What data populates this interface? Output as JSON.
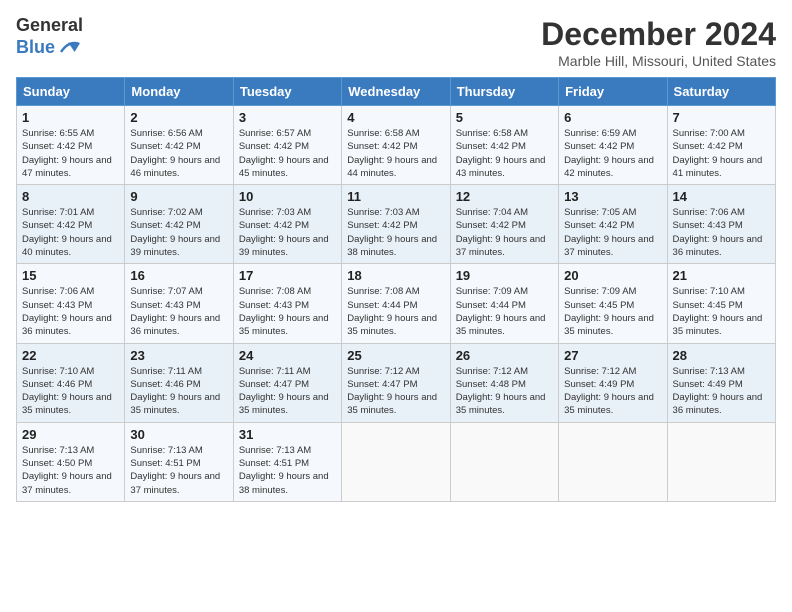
{
  "logo": {
    "general": "General",
    "blue": "Blue"
  },
  "title": "December 2024",
  "location": "Marble Hill, Missouri, United States",
  "days_of_week": [
    "Sunday",
    "Monday",
    "Tuesday",
    "Wednesday",
    "Thursday",
    "Friday",
    "Saturday"
  ],
  "weeks": [
    [
      {
        "day": "1",
        "sunrise": "6:55 AM",
        "sunset": "4:42 PM",
        "daylight": "9 hours and 47 minutes."
      },
      {
        "day": "2",
        "sunrise": "6:56 AM",
        "sunset": "4:42 PM",
        "daylight": "9 hours and 46 minutes."
      },
      {
        "day": "3",
        "sunrise": "6:57 AM",
        "sunset": "4:42 PM",
        "daylight": "9 hours and 45 minutes."
      },
      {
        "day": "4",
        "sunrise": "6:58 AM",
        "sunset": "4:42 PM",
        "daylight": "9 hours and 44 minutes."
      },
      {
        "day": "5",
        "sunrise": "6:58 AM",
        "sunset": "4:42 PM",
        "daylight": "9 hours and 43 minutes."
      },
      {
        "day": "6",
        "sunrise": "6:59 AM",
        "sunset": "4:42 PM",
        "daylight": "9 hours and 42 minutes."
      },
      {
        "day": "7",
        "sunrise": "7:00 AM",
        "sunset": "4:42 PM",
        "daylight": "9 hours and 41 minutes."
      }
    ],
    [
      {
        "day": "8",
        "sunrise": "7:01 AM",
        "sunset": "4:42 PM",
        "daylight": "9 hours and 40 minutes."
      },
      {
        "day": "9",
        "sunrise": "7:02 AM",
        "sunset": "4:42 PM",
        "daylight": "9 hours and 39 minutes."
      },
      {
        "day": "10",
        "sunrise": "7:03 AM",
        "sunset": "4:42 PM",
        "daylight": "9 hours and 39 minutes."
      },
      {
        "day": "11",
        "sunrise": "7:03 AM",
        "sunset": "4:42 PM",
        "daylight": "9 hours and 38 minutes."
      },
      {
        "day": "12",
        "sunrise": "7:04 AM",
        "sunset": "4:42 PM",
        "daylight": "9 hours and 37 minutes."
      },
      {
        "day": "13",
        "sunrise": "7:05 AM",
        "sunset": "4:42 PM",
        "daylight": "9 hours and 37 minutes."
      },
      {
        "day": "14",
        "sunrise": "7:06 AM",
        "sunset": "4:43 PM",
        "daylight": "9 hours and 36 minutes."
      }
    ],
    [
      {
        "day": "15",
        "sunrise": "7:06 AM",
        "sunset": "4:43 PM",
        "daylight": "9 hours and 36 minutes."
      },
      {
        "day": "16",
        "sunrise": "7:07 AM",
        "sunset": "4:43 PM",
        "daylight": "9 hours and 36 minutes."
      },
      {
        "day": "17",
        "sunrise": "7:08 AM",
        "sunset": "4:43 PM",
        "daylight": "9 hours and 35 minutes."
      },
      {
        "day": "18",
        "sunrise": "7:08 AM",
        "sunset": "4:44 PM",
        "daylight": "9 hours and 35 minutes."
      },
      {
        "day": "19",
        "sunrise": "7:09 AM",
        "sunset": "4:44 PM",
        "daylight": "9 hours and 35 minutes."
      },
      {
        "day": "20",
        "sunrise": "7:09 AM",
        "sunset": "4:45 PM",
        "daylight": "9 hours and 35 minutes."
      },
      {
        "day": "21",
        "sunrise": "7:10 AM",
        "sunset": "4:45 PM",
        "daylight": "9 hours and 35 minutes."
      }
    ],
    [
      {
        "day": "22",
        "sunrise": "7:10 AM",
        "sunset": "4:46 PM",
        "daylight": "9 hours and 35 minutes."
      },
      {
        "day": "23",
        "sunrise": "7:11 AM",
        "sunset": "4:46 PM",
        "daylight": "9 hours and 35 minutes."
      },
      {
        "day": "24",
        "sunrise": "7:11 AM",
        "sunset": "4:47 PM",
        "daylight": "9 hours and 35 minutes."
      },
      {
        "day": "25",
        "sunrise": "7:12 AM",
        "sunset": "4:47 PM",
        "daylight": "9 hours and 35 minutes."
      },
      {
        "day": "26",
        "sunrise": "7:12 AM",
        "sunset": "4:48 PM",
        "daylight": "9 hours and 35 minutes."
      },
      {
        "day": "27",
        "sunrise": "7:12 AM",
        "sunset": "4:49 PM",
        "daylight": "9 hours and 35 minutes."
      },
      {
        "day": "28",
        "sunrise": "7:13 AM",
        "sunset": "4:49 PM",
        "daylight": "9 hours and 36 minutes."
      }
    ],
    [
      {
        "day": "29",
        "sunrise": "7:13 AM",
        "sunset": "4:50 PM",
        "daylight": "9 hours and 37 minutes."
      },
      {
        "day": "30",
        "sunrise": "7:13 AM",
        "sunset": "4:51 PM",
        "daylight": "9 hours and 37 minutes."
      },
      {
        "day": "31",
        "sunrise": "7:13 AM",
        "sunset": "4:51 PM",
        "daylight": "9 hours and 38 minutes."
      },
      null,
      null,
      null,
      null
    ]
  ]
}
